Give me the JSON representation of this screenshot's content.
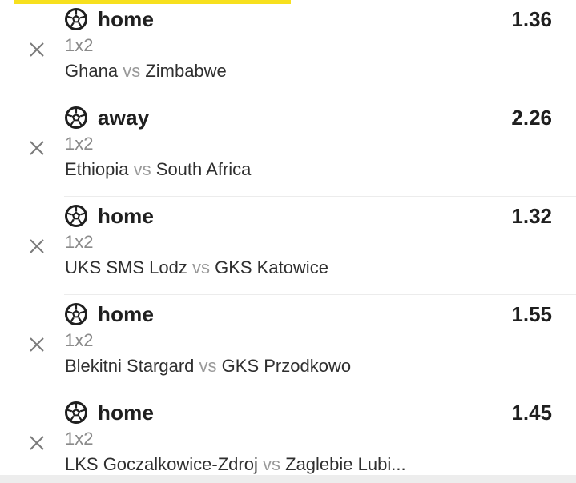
{
  "bets": [
    {
      "selection": "home",
      "odds": "1.36",
      "market": "1x2",
      "home_team": "Ghana",
      "vs": "vs",
      "away_team": "Zimbabwe",
      "icon": "soccer-ball-icon",
      "remove_icon": "close-icon"
    },
    {
      "selection": "away",
      "odds": "2.26",
      "market": "1x2",
      "home_team": "Ethiopia",
      "vs": "vs",
      "away_team": "South Africa",
      "icon": "soccer-ball-icon",
      "remove_icon": "close-icon"
    },
    {
      "selection": "home",
      "odds": "1.32",
      "market": "1x2",
      "home_team": "UKS SMS Lodz",
      "vs": "vs",
      "away_team": "GKS Katowice",
      "icon": "soccer-ball-icon",
      "remove_icon": "close-icon"
    },
    {
      "selection": "home",
      "odds": "1.55",
      "market": "1x2",
      "home_team": "Blekitni Stargard",
      "vs": "vs",
      "away_team": "GKS Przodkowo",
      "icon": "soccer-ball-icon",
      "remove_icon": "close-icon"
    },
    {
      "selection": "home",
      "odds": "1.45",
      "market": "1x2",
      "home_team": "LKS Goczalkowice-Zdroj",
      "vs": "vs",
      "away_team": "Zaglebie Lubi...",
      "icon": "soccer-ball-icon",
      "remove_icon": "close-icon"
    }
  ],
  "colors": {
    "accent": "#f7e01e",
    "text_primary": "#1f1f1f",
    "text_secondary": "#8a8a8a",
    "divider": "#ececec"
  }
}
